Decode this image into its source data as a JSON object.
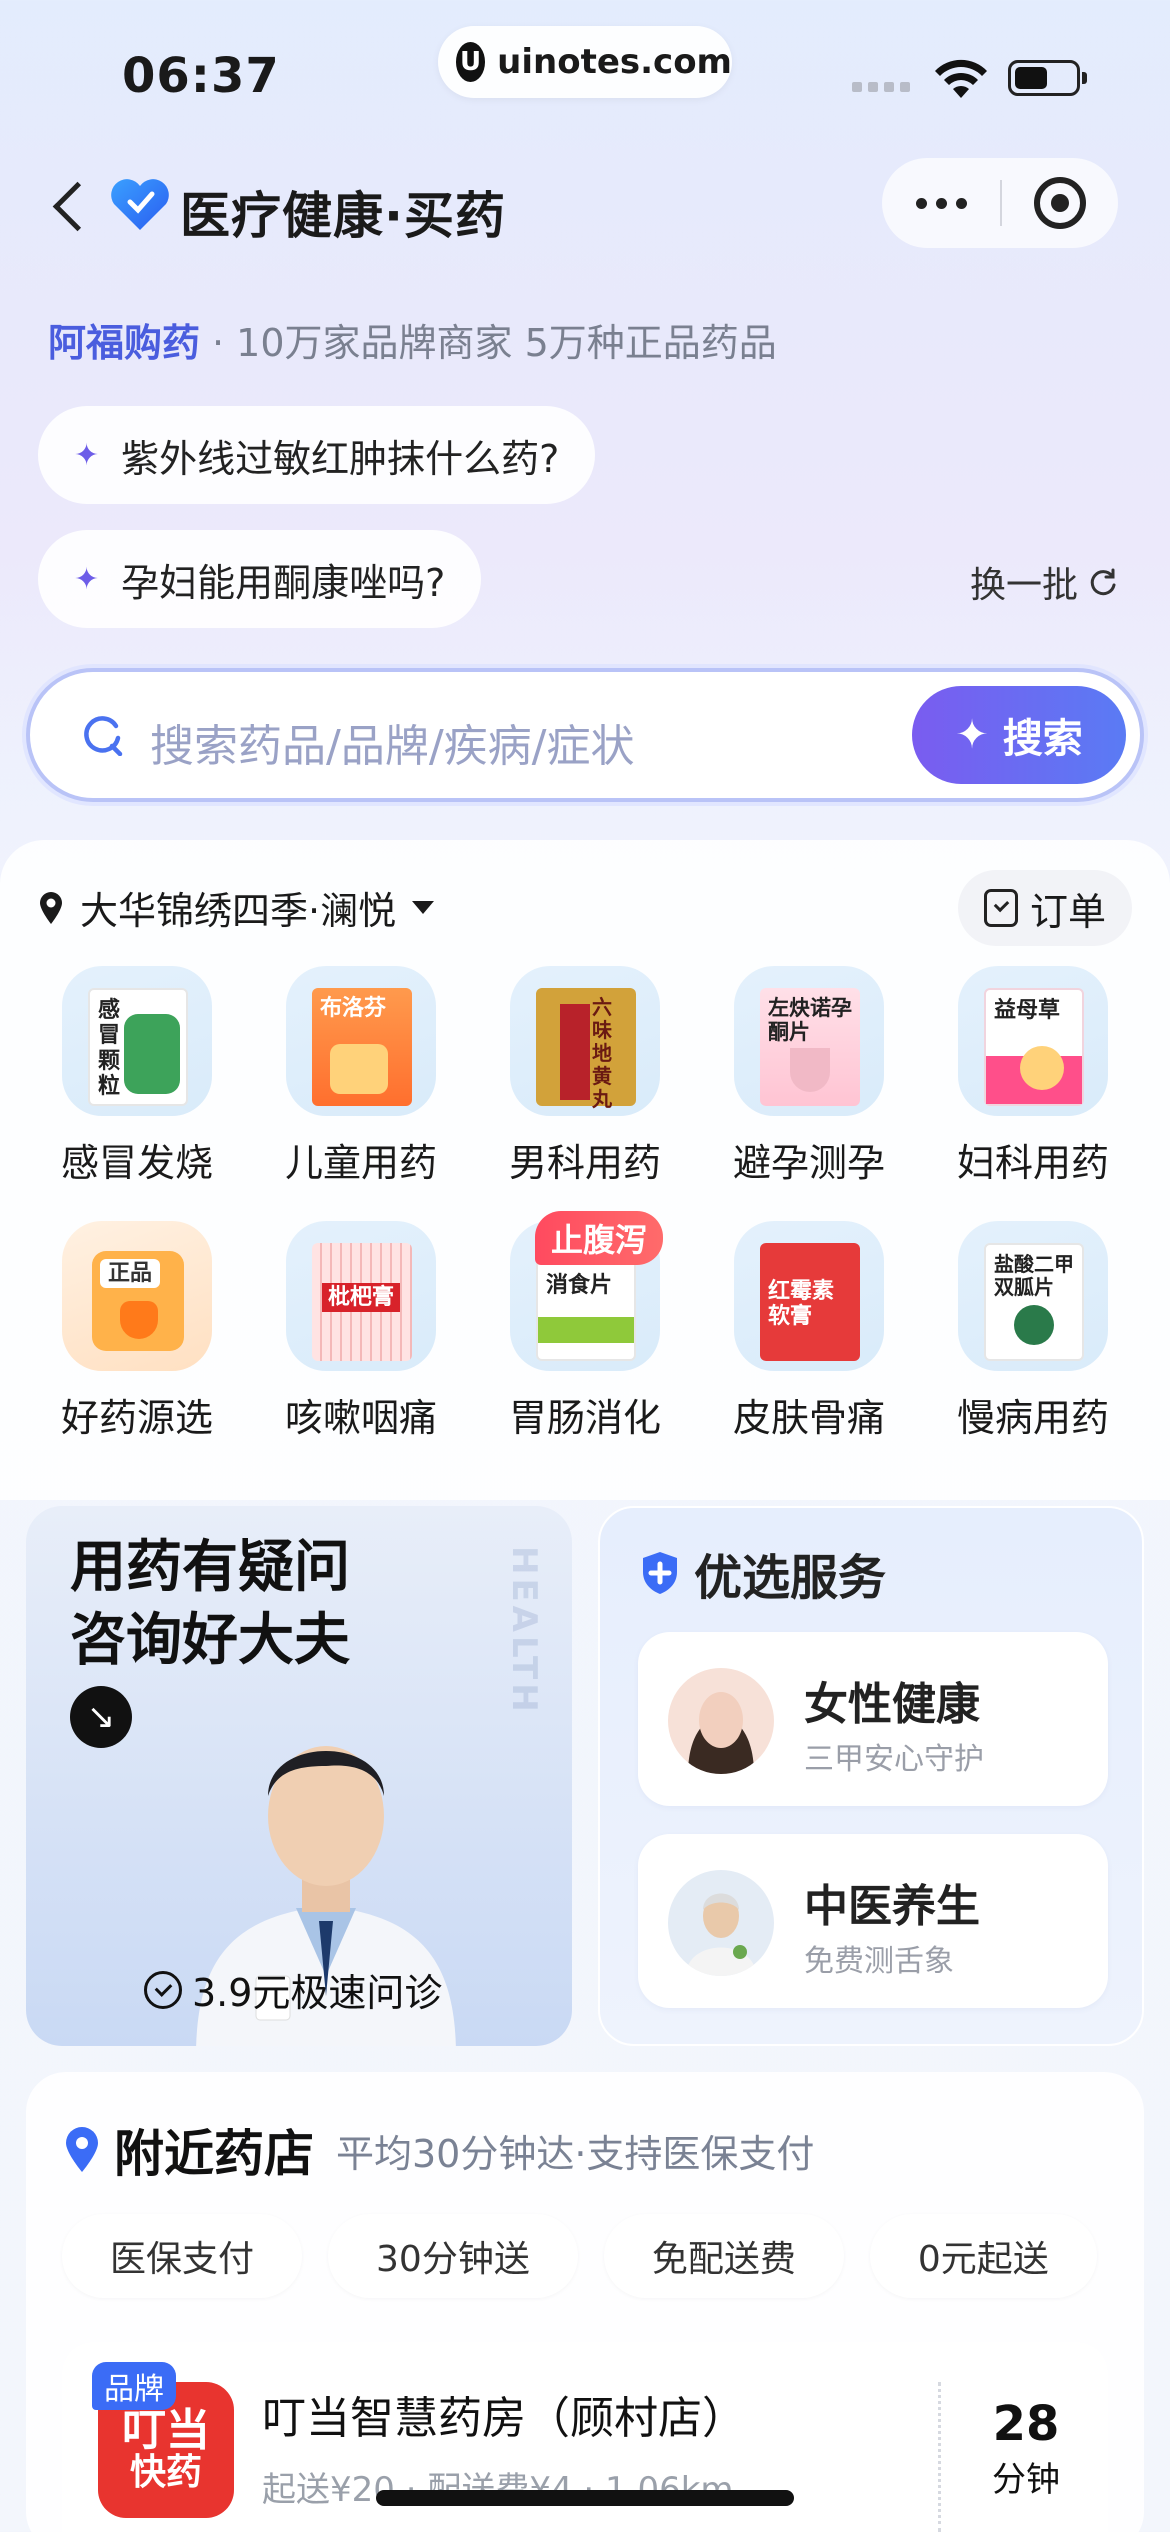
{
  "status_bar": {
    "time": "06:37",
    "url": "uinotes.com",
    "url_icon": "U",
    "battery_level": 0.55
  },
  "nav": {
    "title": "医疗健康·买药"
  },
  "tagline": {
    "brand": "阿福购药",
    "text": "· 10万家品牌商家 5万种正品药品"
  },
  "suggestions": [
    {
      "text": "紫外线过敏红肿抹什么药?"
    },
    {
      "text": "孕妇能用酮康唑吗?"
    }
  ],
  "refresh_label": "换一批",
  "search": {
    "placeholder": "搜索药品/品牌/疾病/症状",
    "button": "搜索"
  },
  "location": {
    "name": "大华锦绣四季·澜悦"
  },
  "order_label": "订单",
  "categories": [
    {
      "label": "感冒发烧",
      "box_text": "感冒颗粒",
      "box_color": "#ffffff",
      "accent": "#3da35a"
    },
    {
      "label": "儿童用药",
      "box_text": "布洛芬",
      "box_color": "#ff8a3d",
      "accent": "#ffd27a"
    },
    {
      "label": "男科用药",
      "box_text": "六味地黄丸",
      "box_color": "#d2a23a",
      "accent": "#b8222a"
    },
    {
      "label": "避孕测孕",
      "box_text": "左炔诺孕酮片",
      "box_color": "#ffd1dc",
      "accent": "#d83a5a"
    },
    {
      "label": "妇科用药",
      "box_text": "益母草",
      "box_color": "#ffffff",
      "accent": "#ff4f8a"
    },
    {
      "label": "好药源选",
      "box_text": "正品",
      "box_color": "#ffb24a",
      "accent": "#ff7a1a"
    },
    {
      "label": "咳嗽咽痛",
      "box_text": "枇杷膏",
      "box_color": "#ffe3e3",
      "accent": "#d8222a"
    },
    {
      "label": "胃肠消化",
      "box_text": "消食片",
      "box_color": "#ffffff",
      "accent": "#8fc93a",
      "badge": "止腹泻"
    },
    {
      "label": "皮肤骨痛",
      "box_text": "红霉素软膏",
      "box_color": "#e63a3a",
      "accent": "#ffffff"
    },
    {
      "label": "慢病用药",
      "box_text": "盐酸二甲双胍片",
      "box_color": "#ffffff",
      "accent": "#2a7a4a"
    }
  ],
  "promo": {
    "title_line1": "用药有疑问",
    "title_line2": "咨询好大夫",
    "watermark": "HEALTH",
    "cta": "3.9元极速问诊"
  },
  "services": {
    "title": "优选服务",
    "items": [
      {
        "title": "女性健康",
        "subtitle": "三甲安心守护"
      },
      {
        "title": "中医养生",
        "subtitle": "免费测舌象"
      }
    ]
  },
  "pharmacy": {
    "title": "附近药店",
    "subtitle": "平均30分钟达·支持医保支付",
    "filters": [
      "医保支付",
      "30分钟送",
      "免配送费",
      "0元起送"
    ],
    "store": {
      "badge": "品牌",
      "logo_line1": "叮当",
      "logo_line2": "快药",
      "name": "叮当智慧药房（顾村店）",
      "meta": "起送¥20 · 配送费¥4 · 1.06km",
      "eta_value": "28",
      "eta_unit": "分钟"
    }
  }
}
